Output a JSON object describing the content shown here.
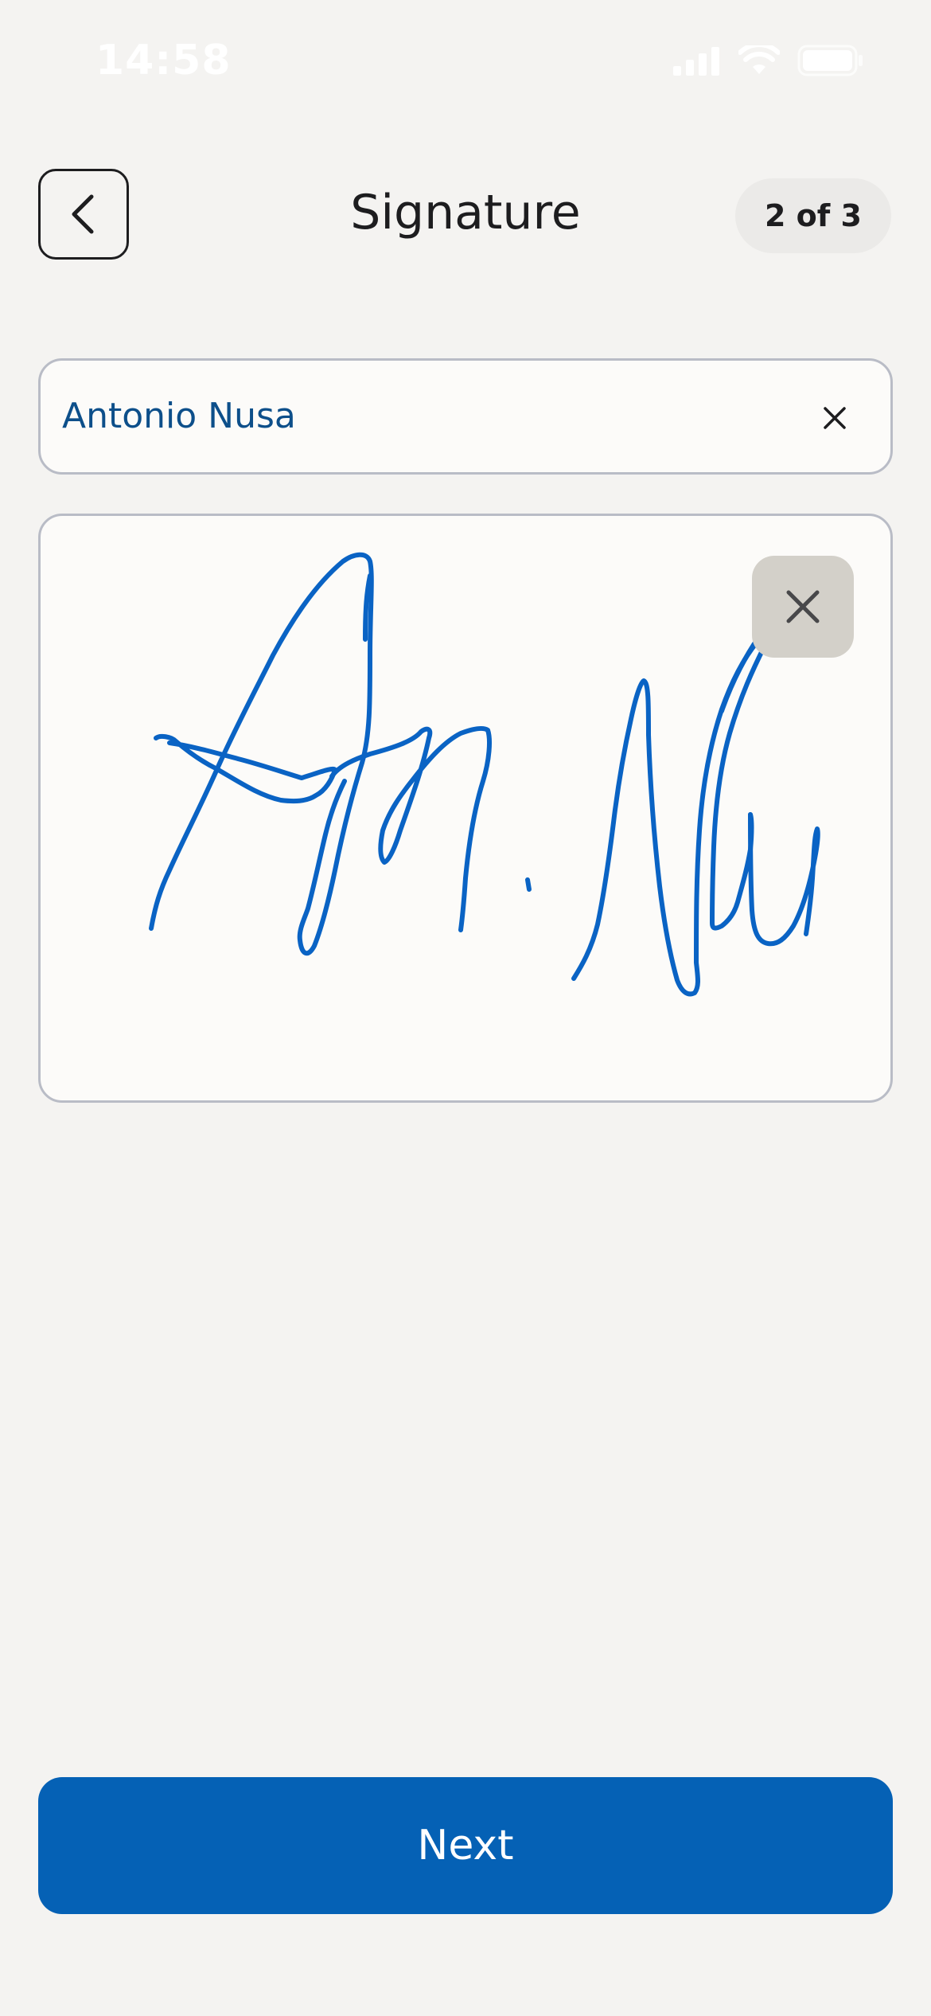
{
  "status_bar": {
    "time": "14:58",
    "icons": [
      "cellular-signal-icon",
      "wifi-icon",
      "battery-icon"
    ]
  },
  "header": {
    "back_icon": "chevron-left-icon",
    "title": "Signature",
    "step": "2 of 3"
  },
  "name_field": {
    "value": "Antonio Nusa",
    "clear_icon": "close-icon"
  },
  "signature_pad": {
    "has_signature": true,
    "ink_color": "#0a63c4",
    "clear_icon": "close-icon"
  },
  "footer": {
    "next_label": "Next"
  },
  "colors": {
    "background": "#f4f3f1",
    "accent": "#0561b5",
    "name_text": "#0d4f8a",
    "title_text": "#1d1d1f"
  }
}
